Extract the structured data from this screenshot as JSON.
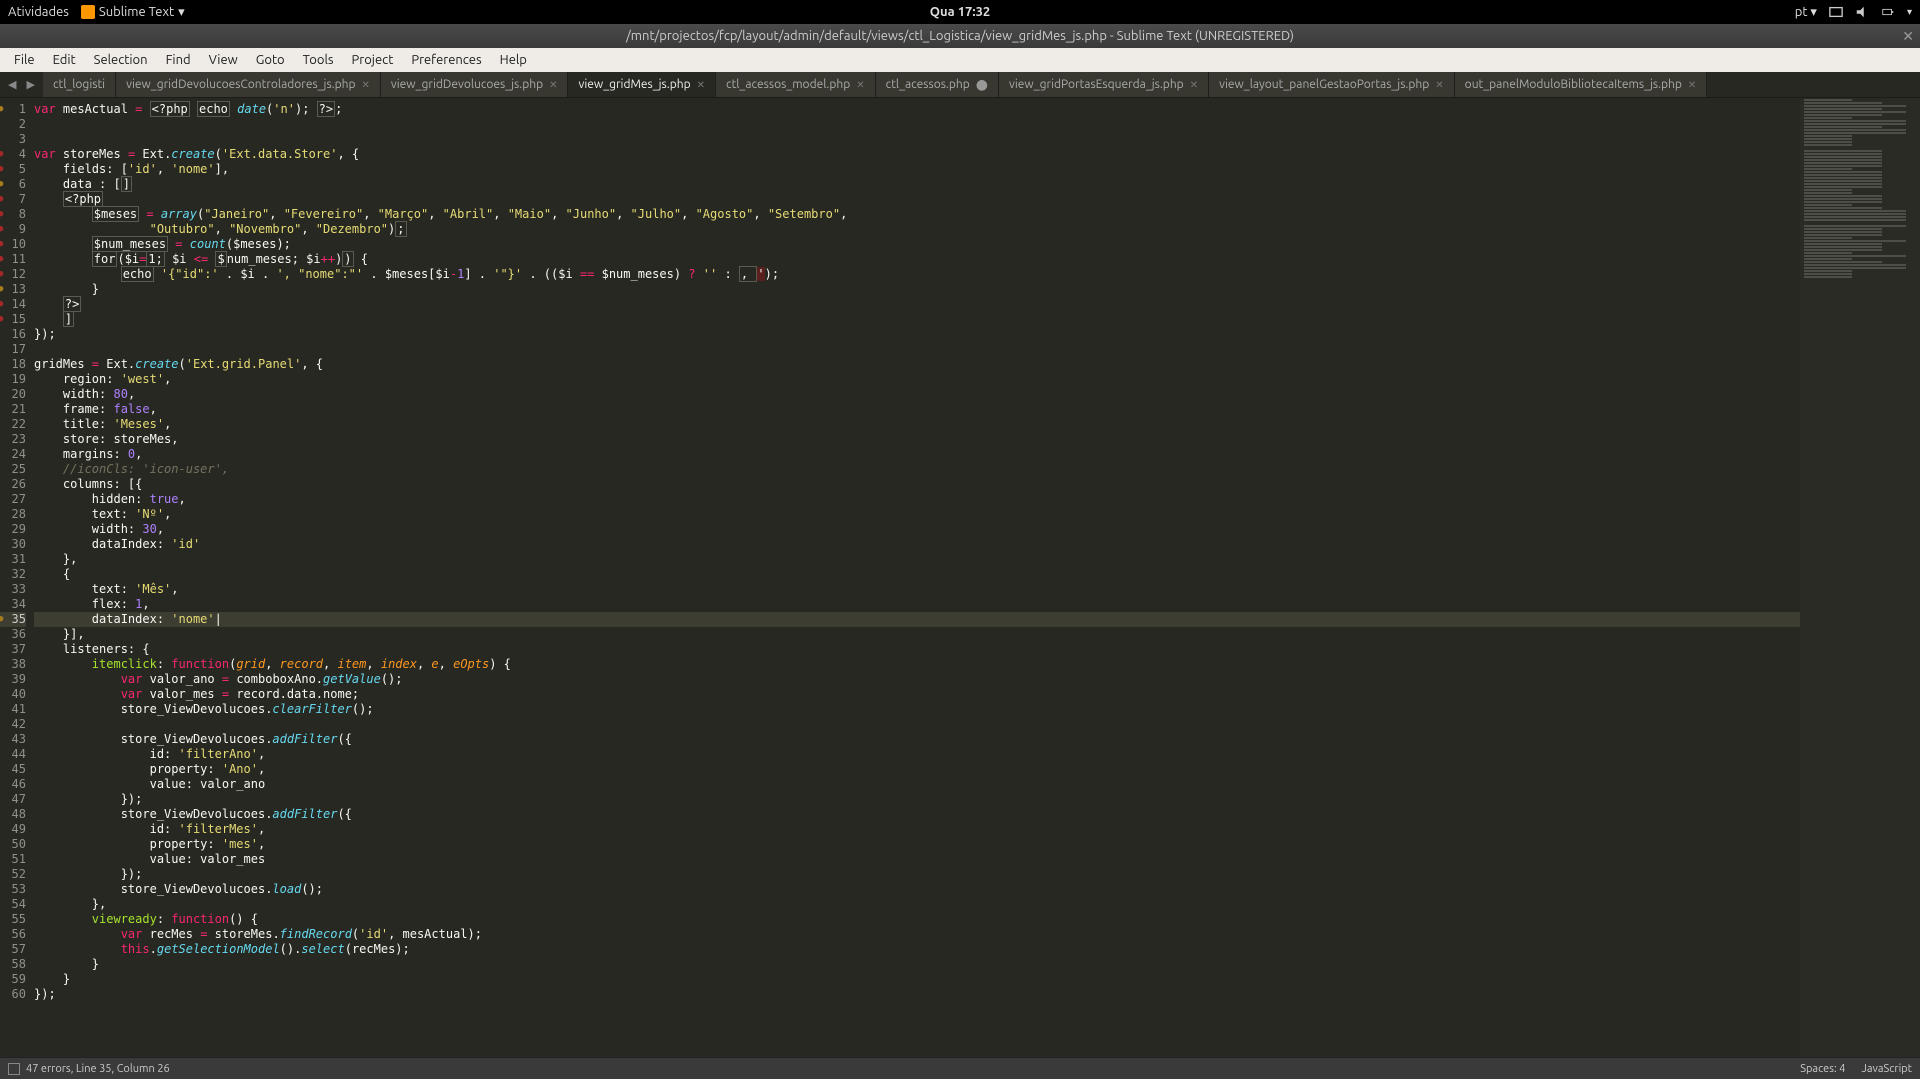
{
  "system_bar": {
    "activities": "Atividades",
    "app_name": "Sublime Text",
    "clock": "Qua 17:32",
    "lang": "pt"
  },
  "window": {
    "title": "/mnt/projectos/fcp/layout/admin/default/views/ctl_Logistica/view_gridMes_js.php - Sublime Text (UNREGISTERED)"
  },
  "menu": [
    "File",
    "Edit",
    "Selection",
    "Find",
    "View",
    "Goto",
    "Tools",
    "Project",
    "Preferences",
    "Help"
  ],
  "tabs": [
    {
      "label": "ctl_logisti",
      "active": false,
      "dirty": false,
      "close": false
    },
    {
      "label": "view_gridDevolucoesControladores_js.php",
      "active": false,
      "dirty": false,
      "close": true
    },
    {
      "label": "view_gridDevolucoes_js.php",
      "active": false,
      "dirty": false,
      "close": true
    },
    {
      "label": "view_gridMes_js.php",
      "active": true,
      "dirty": false,
      "close": true
    },
    {
      "label": "ctl_acessos_model.php",
      "active": false,
      "dirty": false,
      "close": true
    },
    {
      "label": "ctl_acessos.php",
      "active": false,
      "dirty": true,
      "close": false
    },
    {
      "label": "view_gridPortasEsquerda_js.php",
      "active": false,
      "dirty": false,
      "close": true
    },
    {
      "label": "view_layout_panelGestaoPortas_js.php",
      "active": false,
      "dirty": false,
      "close": true
    },
    {
      "label": "out_panelModuloBibliotecaItems_js.php",
      "active": false,
      "dirty": false,
      "close": true
    }
  ],
  "gutter_flags": {
    "err": [
      4,
      5,
      7,
      8,
      9,
      10,
      11,
      12,
      14,
      15
    ],
    "warn": [
      1,
      6,
      13,
      35
    ],
    "current": 35
  },
  "status": {
    "left": "47 errors, Line 35, Column 26",
    "spaces": "Spaces: 4",
    "lang": "JavaScript"
  }
}
